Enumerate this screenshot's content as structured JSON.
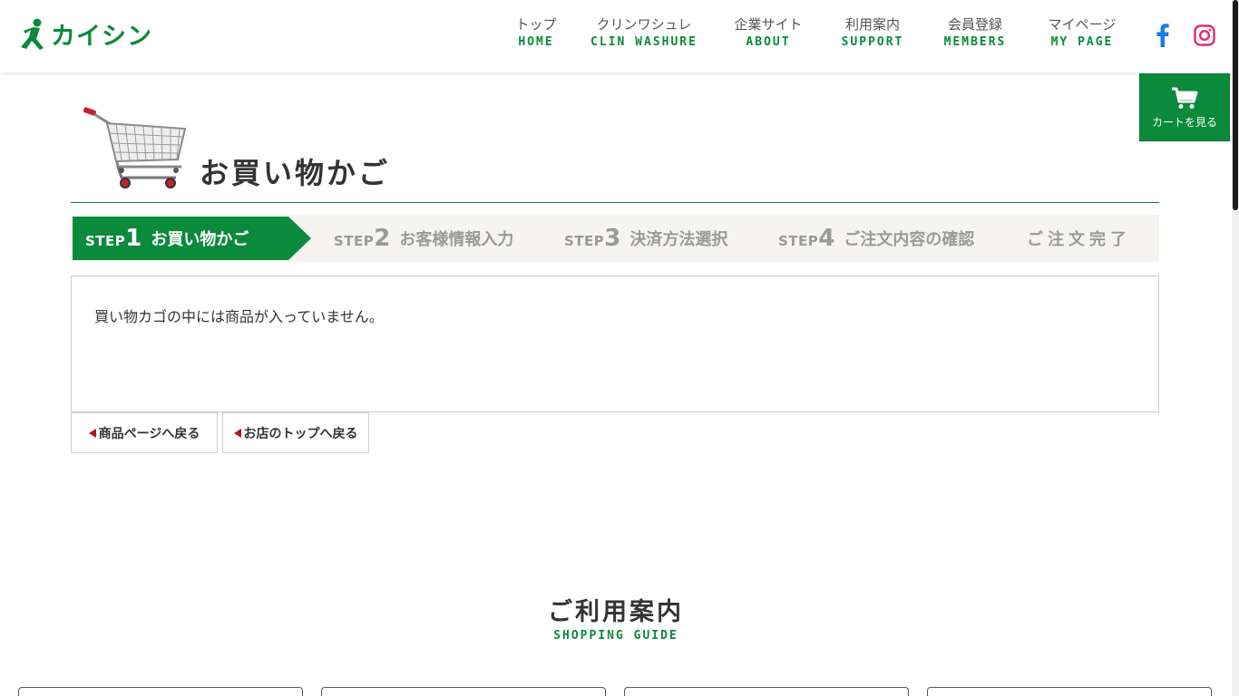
{
  "header": {
    "logo_text": "カイシン",
    "nav": [
      {
        "jp": "トップ",
        "en": "HOME"
      },
      {
        "jp": "クリンワシュレ",
        "en": "CLIN WASHURE"
      },
      {
        "jp": "企業サイト",
        "en": "ABOUT"
      },
      {
        "jp": "利用案内",
        "en": "SUPPORT"
      },
      {
        "jp": "会員登録",
        "en": "MEMBERS"
      },
      {
        "jp": "マイページ",
        "en": "MY PAGE"
      }
    ],
    "facebook_icon": "facebook-icon",
    "instagram_icon": "instagram-icon"
  },
  "cart_button": {
    "label": "カートを見る",
    "icon": "cart-icon"
  },
  "page": {
    "title": "お買い物かご"
  },
  "steps": [
    {
      "prefix": "STEP",
      "num": "1",
      "label": "お買い物かご",
      "active": true
    },
    {
      "prefix": "STEP",
      "num": "2",
      "label": "お客様情報入力",
      "active": false
    },
    {
      "prefix": "STEP",
      "num": "3",
      "label": "決済方法選択",
      "active": false
    },
    {
      "prefix": "STEP",
      "num": "4",
      "label": "ご注文内容の確認",
      "active": false
    },
    {
      "prefix": "",
      "num": "",
      "label": "ご注文完了",
      "active": false
    }
  ],
  "content": {
    "empty_message": "買い物カゴの中には商品が入っていません。"
  },
  "back_buttons": {
    "product": "商品ページへ戻る",
    "top": "お店のトップへ戻る"
  },
  "guide": {
    "title": "ご利用案内",
    "subtitle": "SHOPPING GUIDE"
  },
  "colors": {
    "brand_green": "#0b8a3b",
    "facebook_blue": "#1877f2",
    "instagram_pink": "#e1306c",
    "back_arrow": "#b0151a"
  }
}
